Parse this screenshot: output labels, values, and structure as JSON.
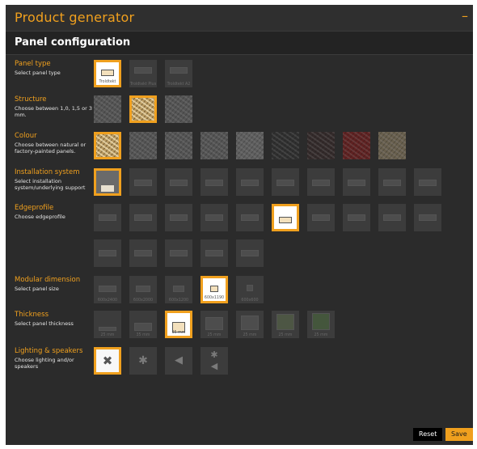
{
  "app": {
    "title": "Product generator",
    "minimize": "–"
  },
  "subtitle": "Panel configuration",
  "sections": {
    "panel_type": {
      "title": "Panel type",
      "desc": "Select panel type",
      "options": [
        "Troldtekt",
        "Troldtekt Plus",
        "Troldtekt A2"
      ]
    },
    "structure": {
      "title": "Structure",
      "desc": "Choose between 1,0, 1,5 or 3 mm."
    },
    "colour": {
      "title": "Colour",
      "desc": "Choose between natural or factory-painted panels."
    },
    "installation": {
      "title": "Installation system",
      "desc": "Select installation system/underlying support"
    },
    "edgeprofile": {
      "title": "Edgeprofile",
      "desc": "Choose edgeprofile"
    },
    "modular": {
      "title": "Modular dimension",
      "desc": "Select panel size",
      "options": [
        "600x2400",
        "600x2000",
        "600x1200",
        "600x1190",
        "600x600"
      ]
    },
    "thickness": {
      "title": "Thickness",
      "desc": "Select panel thickness",
      "options": [
        "25 mm",
        "35 mm",
        "35 mm",
        "25 mm",
        "25 mm",
        "25 mm",
        "25 mm"
      ]
    },
    "lighting": {
      "title": "Lighting & speakers",
      "desc": "Choose lighting and/or speakers"
    }
  },
  "buttons": {
    "reset": "Reset",
    "save": "Save"
  },
  "colors": {
    "accent": "#f0a01e",
    "background": "#2b2b2b"
  }
}
